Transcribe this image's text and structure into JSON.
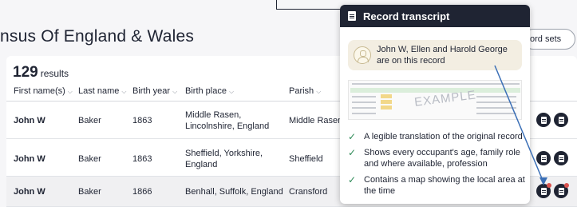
{
  "page": {
    "title": "nsus Of England & Wales",
    "record_sets_label": "ord sets"
  },
  "results": {
    "count": "129",
    "count_label": "results"
  },
  "table": {
    "columns": [
      {
        "label": "First name(s)"
      },
      {
        "label": "Last name"
      },
      {
        "label": "Birth year"
      },
      {
        "label": "Birth place"
      },
      {
        "label": "Parish"
      }
    ],
    "rows": [
      {
        "first_name": "John W",
        "last_name": "Baker",
        "birth_year": "1863",
        "birth_place": "Middle Rasen, Lincolnshire, England",
        "parish": "Middle Rasen"
      },
      {
        "first_name": "John W",
        "last_name": "Baker",
        "birth_year": "1863",
        "birth_place": "Sheffield, Yorkshire, England",
        "parish": "Sheffield"
      },
      {
        "first_name": "John W",
        "last_name": "Baker",
        "birth_year": "1866",
        "birth_place": "Benhall, Suffolk, England",
        "parish": "Cransford"
      }
    ]
  },
  "popup": {
    "title": "Record transcript",
    "occupants_text": "John W, Ellen and Harold George are on this record",
    "example_watermark": "EXAMPLE",
    "features": [
      "A legible translation of the original record",
      "Shows every occupant's age, family role and where available, profession",
      "Contains a map showing the local area at the time"
    ]
  },
  "icons": {
    "transcript": "document-icon",
    "image": "image-document-icon",
    "check": "check-icon",
    "people": "people-icon",
    "chevron": "chevron-down-icon"
  },
  "colors": {
    "navy": "#1f2433",
    "check_green": "#2e8a57",
    "arrow_blue": "#3b6fb6",
    "occupants_bg": "#f3eee2"
  }
}
